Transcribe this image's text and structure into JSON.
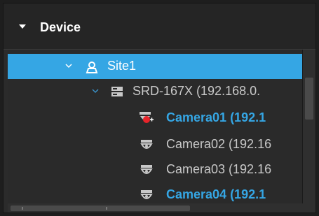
{
  "panel": {
    "title": "Device"
  },
  "tree": {
    "site": {
      "label": "Site1"
    },
    "device": {
      "label": "SRD-167X (192.168.0."
    },
    "cameras": [
      {
        "label": "Camera01 (192.1",
        "state": "active"
      },
      {
        "label": "Camera02 (192.16",
        "state": "normal"
      },
      {
        "label": "Camera03 (192.16",
        "state": "normal"
      },
      {
        "label": "Camera04 (192.1",
        "state": "active"
      }
    ]
  },
  "colors": {
    "selection": "#35a6e4",
    "active_text": "#35a6e4",
    "normal_text": "#c8c8c8",
    "alarm": "#e8242a"
  },
  "icons": {
    "expand": "chevron-down-icon",
    "site": "site-person-icon",
    "device": "recorder-icon",
    "camera": "dome-camera-icon",
    "camera_alarm": "camera-alarm-icon"
  }
}
